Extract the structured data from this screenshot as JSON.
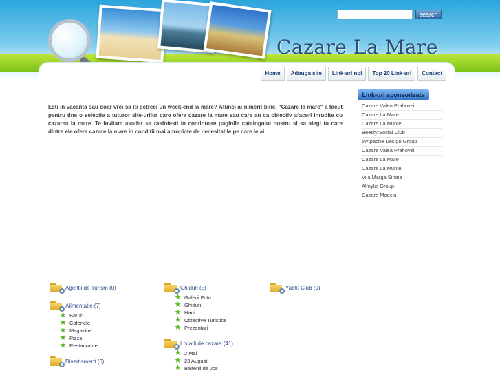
{
  "header": {
    "site_title": "Cazare La Mare",
    "search_placeholder": "",
    "search_button": "search"
  },
  "nav": {
    "tabs": [
      "Home",
      "Adauga site",
      "Link-uri noi",
      "Top 20 Link-uri",
      "Contact"
    ]
  },
  "intro_text": "Esti in vacanta sau doar vrei sa iti petreci un week-end la mare? Atunci ai nimerit bine. \"Cazare la mare\" a facut pentru tine o selectie a tuturor site-urilor care ofera cazare la mare sau care au ca obiectiv afaceri inrudite cu cazarea la mare. Te invitam asadar sa rasfoiesti in continuare paginile catalogului nostru si sa alegi tu care dintre ele ofera cazare la mare in conditii mai apropiate de necesitatile pe care le ai.",
  "sponsors": {
    "title": "Link-uri sponsorizate",
    "items": [
      "Cazare Valea Prahovei",
      "Cazare La Mare",
      "Cazare La Munte",
      "Beetzy Social Club",
      "WApache Design Group",
      "Cazare Valea Prahovei",
      "Cazare La Mare",
      "Cazare La Munte",
      "Vila Marga Sinaia",
      "Almylia Group",
      "Cazare Moeciu"
    ]
  },
  "categories": {
    "col1": [
      {
        "title": "Agentii de Turism (0)",
        "subs": []
      },
      {
        "title": "Alimentatie (7)",
        "subs": [
          "Baruri",
          "Cafenele",
          "Magazine",
          "Pizza",
          "Restaurante"
        ]
      },
      {
        "title": "Divertisment (6)",
        "subs": []
      }
    ],
    "col2": [
      {
        "title": "Ghiduri (5)",
        "subs": [
          "Galerii Foto",
          "Ghiduri",
          "Harti",
          "Obiective Turistice",
          "Prezentari"
        ]
      },
      {
        "title": "Locatii de cazare (41)",
        "subs": [
          "2 Mai",
          "23 August",
          "Baltenii de Jos"
        ]
      }
    ],
    "col3": [
      {
        "title": "Yacht Club (0)",
        "subs": []
      }
    ]
  },
  "icons": {
    "folder": "folder-search-icon",
    "star": "green-star-icon",
    "magnifier": "magnifying-glass-icon"
  },
  "colors": {
    "sky": "#2aa5dc",
    "green_band": "#8fd126",
    "link_blue": "#2a4a8c",
    "star_green": "#57b521"
  }
}
